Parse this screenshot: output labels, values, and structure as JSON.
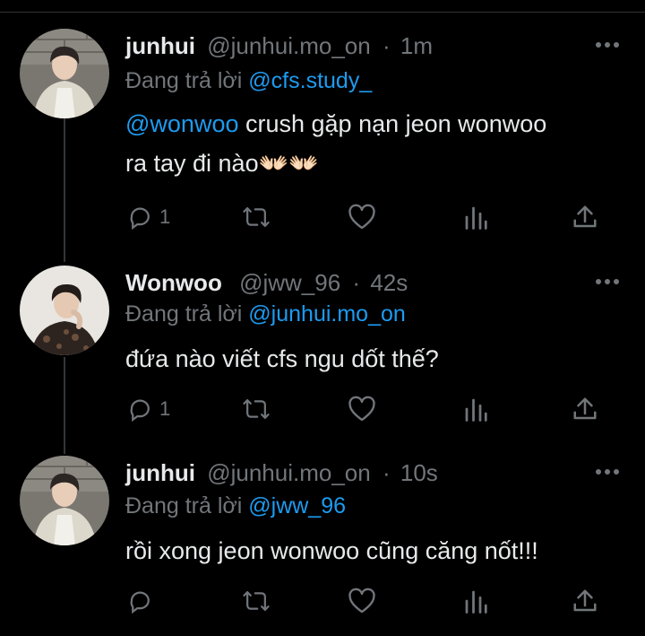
{
  "tweets": [
    {
      "name": "junhui",
      "handle": "@junhui.mo_on",
      "time": "1m",
      "reply_prefix": "Đang trả lời",
      "reply_to": "@cfs.study_",
      "mention": "@wonwoo",
      "line1_rest": "crush gặp nạn jeon wonwoo",
      "line2": "ra tay đi nào👐🏻👐🏻",
      "reply_count": "1"
    },
    {
      "name": "Wonwoo",
      "handle": "@jww_96",
      "time": "42s",
      "reply_prefix": "Đang trả lời",
      "reply_to": "@junhui.mo_on",
      "line1": "đứa nào viết cfs ngu dốt thế?",
      "reply_count": "1"
    },
    {
      "name": "junhui",
      "handle": "@junhui.mo_on",
      "time": "10s",
      "reply_prefix": "Đang trả lời",
      "reply_to": "@jww_96",
      "line1": "rồi xong jeon wonwoo cũng căng nốt!!!",
      "reply_count": ""
    }
  ],
  "icons": {
    "reply": "reply-icon",
    "retweet": "retweet-icon",
    "like": "heart-icon",
    "views": "analytics-icon",
    "share": "share-icon",
    "more": "more-options-icon"
  },
  "colors": {
    "background": "#000000",
    "text": "#e7e9ea",
    "muted": "#71767b",
    "link": "#1d9bf0"
  },
  "separator": "·"
}
